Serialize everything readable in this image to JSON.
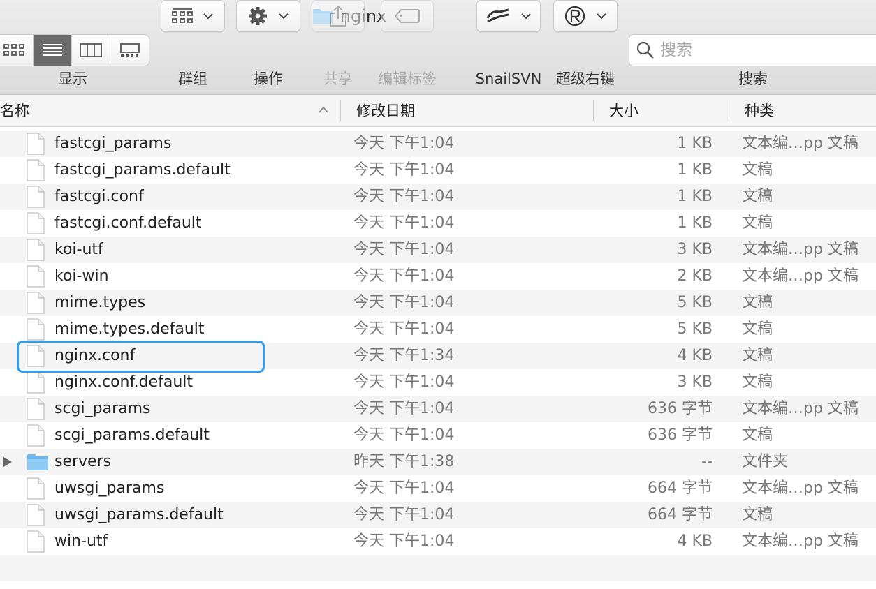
{
  "window": {
    "title": "nginx"
  },
  "toolbar": {
    "view_label": "显示",
    "group_label": "群组",
    "action_label": "操作",
    "share_label": "共享",
    "tags_label": "编辑标签",
    "snailsvn_label": "SnailSVN",
    "super_right_label": "超级右键",
    "search_label": "搜索",
    "search_placeholder": "搜索"
  },
  "columns": {
    "name": "名称",
    "date": "修改日期",
    "size": "大小",
    "kind": "种类"
  },
  "files": [
    {
      "name": "fastcgi_params",
      "date": "今天 下午1:04",
      "size": "1 KB",
      "kind": "文本编…pp 文稿",
      "type": "file"
    },
    {
      "name": "fastcgi_params.default",
      "date": "今天 下午1:04",
      "size": "1 KB",
      "kind": "文稿",
      "type": "file"
    },
    {
      "name": "fastcgi.conf",
      "date": "今天 下午1:04",
      "size": "1 KB",
      "kind": "文稿",
      "type": "file"
    },
    {
      "name": "fastcgi.conf.default",
      "date": "今天 下午1:04",
      "size": "1 KB",
      "kind": "文稿",
      "type": "file"
    },
    {
      "name": "koi-utf",
      "date": "今天 下午1:04",
      "size": "3 KB",
      "kind": "文本编…pp 文稿",
      "type": "file"
    },
    {
      "name": "koi-win",
      "date": "今天 下午1:04",
      "size": "2 KB",
      "kind": "文本编…pp 文稿",
      "type": "file"
    },
    {
      "name": "mime.types",
      "date": "今天 下午1:04",
      "size": "5 KB",
      "kind": "文稿",
      "type": "file"
    },
    {
      "name": "mime.types.default",
      "date": "今天 下午1:04",
      "size": "5 KB",
      "kind": "文稿",
      "type": "file"
    },
    {
      "name": "nginx.conf",
      "date": "今天 下午1:34",
      "size": "4 KB",
      "kind": "文稿",
      "type": "file"
    },
    {
      "name": "nginx.conf.default",
      "date": "今天 下午1:04",
      "size": "3 KB",
      "kind": "文稿",
      "type": "file"
    },
    {
      "name": "scgi_params",
      "date": "今天 下午1:04",
      "size": "636 字节",
      "kind": "文本编…pp 文稿",
      "type": "file"
    },
    {
      "name": "scgi_params.default",
      "date": "今天 下午1:04",
      "size": "636 字节",
      "kind": "文稿",
      "type": "file"
    },
    {
      "name": "servers",
      "date": "昨天 下午1:38",
      "size": "--",
      "kind": "文件夹",
      "type": "folder"
    },
    {
      "name": "uwsgi_params",
      "date": "今天 下午1:04",
      "size": "664 字节",
      "kind": "文本编…pp 文稿",
      "type": "file"
    },
    {
      "name": "uwsgi_params.default",
      "date": "今天 下午1:04",
      "size": "664 字节",
      "kind": "文稿",
      "type": "file"
    },
    {
      "name": "win-utf",
      "date": "今天 下午1:04",
      "size": "4 KB",
      "kind": "文本编…pp 文稿",
      "type": "file"
    }
  ],
  "colors": {
    "highlight": "#2f9ef4",
    "folder": "#6cb8ee"
  }
}
